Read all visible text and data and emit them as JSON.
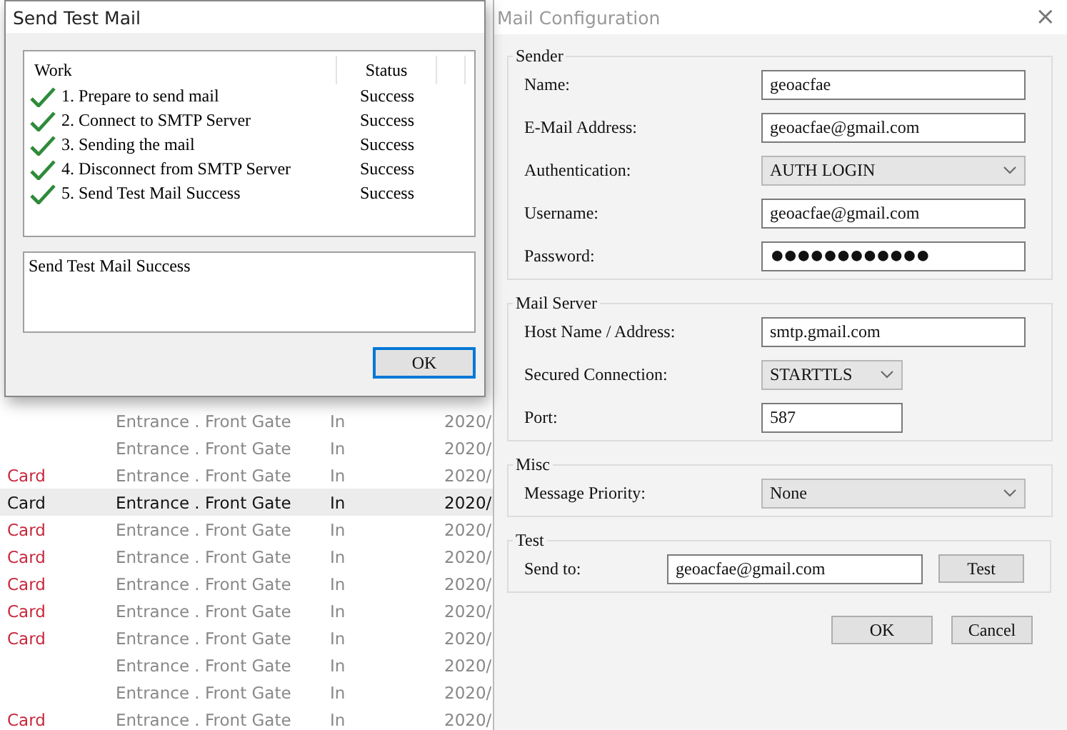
{
  "background_list": {
    "rows": [
      {
        "column_2": "Entrance . Front Gate",
        "column_3": "In",
        "column_4": "2020/",
        "selected": false
      },
      {
        "column_2": "Entrance . Front Gate",
        "column_3": "In",
        "column_4": "2020/",
        "selected": false
      },
      {
        "column_1": "Card",
        "column_2": "Entrance . Front Gate",
        "column_3": "In",
        "column_4": "2020/",
        "selected": false
      },
      {
        "column_1": "Card",
        "column_2": "Entrance . Front Gate",
        "column_3": "In",
        "column_4": "2020/",
        "selected": true
      },
      {
        "column_1": "Card",
        "column_2": "Entrance . Front Gate",
        "column_3": "In",
        "column_4": "2020/",
        "selected": false
      },
      {
        "column_1": "Card",
        "column_2": "Entrance . Front Gate",
        "column_3": "In",
        "column_4": "2020/",
        "selected": false
      },
      {
        "column_1": "Card",
        "column_2": "Entrance . Front Gate",
        "column_3": "In",
        "column_4": "2020/",
        "selected": false
      },
      {
        "column_1": "Card",
        "column_2": "Entrance . Front Gate",
        "column_3": "In",
        "column_4": "2020/",
        "selected": false
      },
      {
        "column_1": "Card",
        "column_2": "Entrance . Front Gate",
        "column_3": "In",
        "column_4": "2020/",
        "selected": false
      },
      {
        "column_2": "Entrance . Front Gate",
        "column_3": "In",
        "column_4": "2020/",
        "selected": false
      },
      {
        "column_2": "Entrance . Front Gate",
        "column_3": "In",
        "column_4": "2020/",
        "selected": false
      },
      {
        "column_1": "Card",
        "column_2": "Entrance . Front Gate",
        "column_3": "In",
        "column_4": "2020/",
        "selected": false
      }
    ]
  },
  "test_dialog": {
    "title": "Send Test Mail",
    "columns": [
      "Work",
      "Status"
    ],
    "rows": [
      {
        "work": "1. Prepare to send mail",
        "status": "Success",
        "checked": true
      },
      {
        "work": "2. Connect to SMTP Server",
        "status": "Success",
        "checked": true
      },
      {
        "work": "3. Sending the mail",
        "status": "Success",
        "checked": true
      },
      {
        "work": "4. Disconnect from SMTP Server",
        "status": "Success",
        "checked": true
      },
      {
        "work": "5. Send Test Mail Success",
        "status": "Success",
        "checked": true
      }
    ],
    "message": "Send Test Mail Success",
    "button": "OK"
  },
  "config_window": {
    "title": "Mail Configuration",
    "close": "×",
    "groups": [
      {
        "legend": "Sender",
        "fields": [
          {
            "label": "Name:",
            "kind": "text",
            "value": "geoacfae",
            "narrow": false
          },
          {
            "label": "E-Mail Address:",
            "kind": "text",
            "value": "geoacfae@gmail.com",
            "narrow": false
          },
          {
            "label": "Authentication:",
            "kind": "select",
            "value": "AUTH LOGIN",
            "narrow": false
          },
          {
            "label": "Username:",
            "kind": "text",
            "value": "geoacfae@gmail.com",
            "narrow": false
          },
          {
            "label": "Password:",
            "kind": "password",
            "value": "●●●●●●●●●●●●",
            "narrow": false
          }
        ]
      },
      {
        "legend": "Mail Server",
        "fields": [
          {
            "label": "Host Name / Address:",
            "kind": "text",
            "value": "smtp.gmail.com",
            "narrow": false
          },
          {
            "label": "Secured Connection:",
            "kind": "select",
            "value": "STARTTLS",
            "narrow": true
          },
          {
            "label": "Port:",
            "kind": "text",
            "value": "587",
            "narrow": true
          }
        ]
      },
      {
        "legend": "Misc",
        "fields": [
          {
            "label": "Message Priority:",
            "kind": "select",
            "value": "None",
            "narrow": false
          }
        ]
      },
      {
        "legend": "Test",
        "fields": [
          {
            "label": "Send to:",
            "kind": "send",
            "value": "geoacfae@gmail.com",
            "button": "Test",
            "narrow": false
          }
        ]
      }
    ],
    "buttons": [
      "OK",
      "Cancel"
    ]
  }
}
